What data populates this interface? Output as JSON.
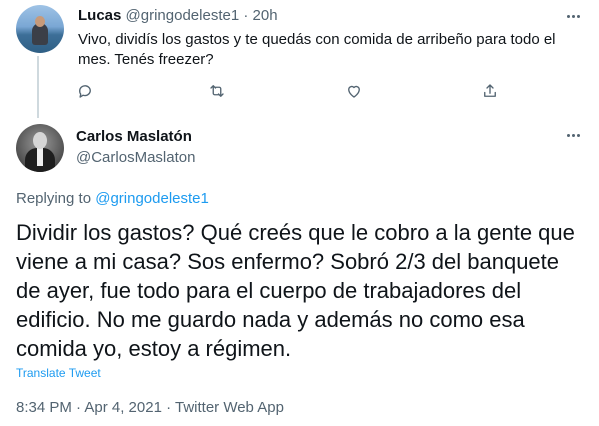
{
  "reply_tweet": {
    "author_name": "Lucas",
    "author_handle": "@gringodeleste1",
    "separator": "·",
    "time": "20h",
    "text": "Vivo, dividís los gastos y te quedás con comida de arribeño para todo el mes. Tenés freezer?",
    "actions": [
      "reply-icon",
      "retweet-icon",
      "like-icon",
      "share-icon"
    ]
  },
  "main_tweet": {
    "author_name": "Carlos Maslatón",
    "author_handle": "@CarlosMaslaton",
    "replying_prefix": "Replying to",
    "replying_to": "@gringodeleste1",
    "text": "Dividir los gastos? Qué creés que le cobro a la gente que viene a mi casa? Sos enfermo? Sobró 2/3 del banquete de ayer, fue todo para el cuerpo de trabajadores del edificio. No me guardo nada y además no como esa comida yo, estoy a régimen.",
    "translate_label": "Translate Tweet",
    "timestamp": "8:34 PM · Apr 4, 2021 · Twitter Web App"
  },
  "colors": {
    "link": "#1d9bf0",
    "secondary_text": "#536471",
    "primary_text": "#0f1419",
    "thread_line": "#cfd9de"
  }
}
